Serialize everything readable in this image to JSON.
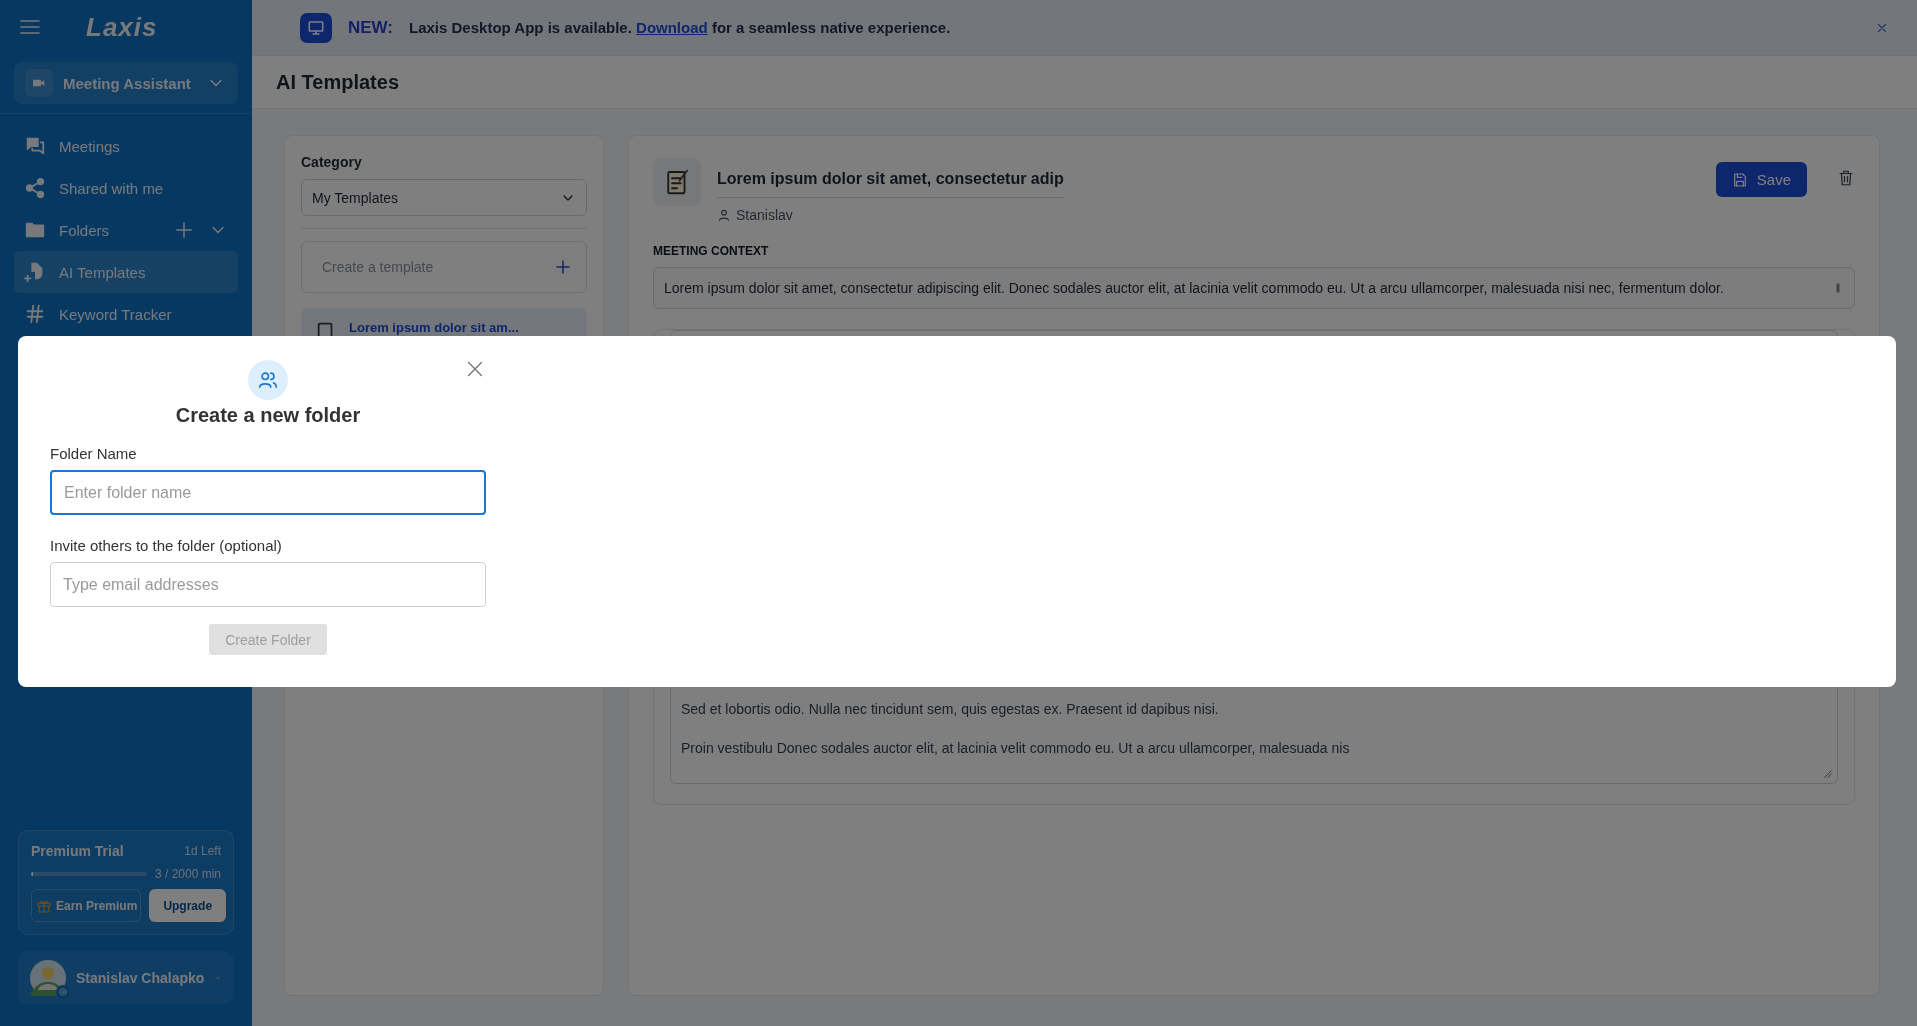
{
  "sidebar": {
    "logo": "Laxis",
    "workspace": {
      "label": "Meeting Assistant"
    },
    "nav": [
      {
        "label": "Meetings",
        "kind": "chat",
        "selected": false
      },
      {
        "label": "Shared with me",
        "kind": "share",
        "selected": false
      },
      {
        "label": "Folders",
        "kind": "folder",
        "selected": false
      },
      {
        "label": "AI Templates",
        "kind": "template",
        "selected": true
      },
      {
        "label": "Keyword Tracker",
        "kind": "hash",
        "selected": false
      }
    ],
    "trial": {
      "title": "Premium Trial",
      "remaining": "1d Left",
      "level": 0.02,
      "usage": "3 / 2000 min",
      "earn_button": "Earn Premium",
      "upgrade_button": "Upgrade"
    },
    "user": {
      "name": "Stanislav Chalapko"
    }
  },
  "banner": {
    "badge": "NEW:",
    "text_before": "Laxis Desktop App is available. ",
    "link": "Download",
    "text_after": " for a seamless native experience."
  },
  "page_title": "AI Templates",
  "category_panel": {
    "label": "Category",
    "select": {
      "value": "My Templates"
    },
    "create": {
      "placeholder": "Create a template"
    },
    "templates": [
      {
        "title": "Lorem ipsum dolor sit am...",
        "selected": true
      }
    ]
  },
  "editor": {
    "title": "Lorem ipsum dolor sit amet, consectetur adip",
    "author": "Stanislav",
    "save_button": "Save",
    "context_label": "MEETING CONTEXT",
    "context": "Lorem ipsum dolor sit amet, consectetur adipiscing elit. Donec sodales auctor elit, at lacinia velit commodo eu. Ut a arcu ullamcorper, malesuada nisi nec, fermentum dolor.",
    "body_paragraphs": [
      [
        "Sed et lobortis odio. Nulla nec tincidunt sem, quis egestas ex. Praesent id dapibus nisi."
      ],
      [
        "Proin vestibulu Donec sodales auctor elit, at lacinia velit commodo eu. Ut a arcu ullamcorper, malesuada nis"
      ]
    ]
  },
  "modal": {
    "title": "Create a new folder",
    "fields": [
      {
        "label": "Folder Name",
        "placeholder": "Enter folder name",
        "focused": true
      },
      {
        "label": "Invite others to the folder (optional)",
        "placeholder": "Type email addresses",
        "focused": false
      }
    ],
    "submit": {
      "label": "Create Folder",
      "disabled": true
    }
  }
}
